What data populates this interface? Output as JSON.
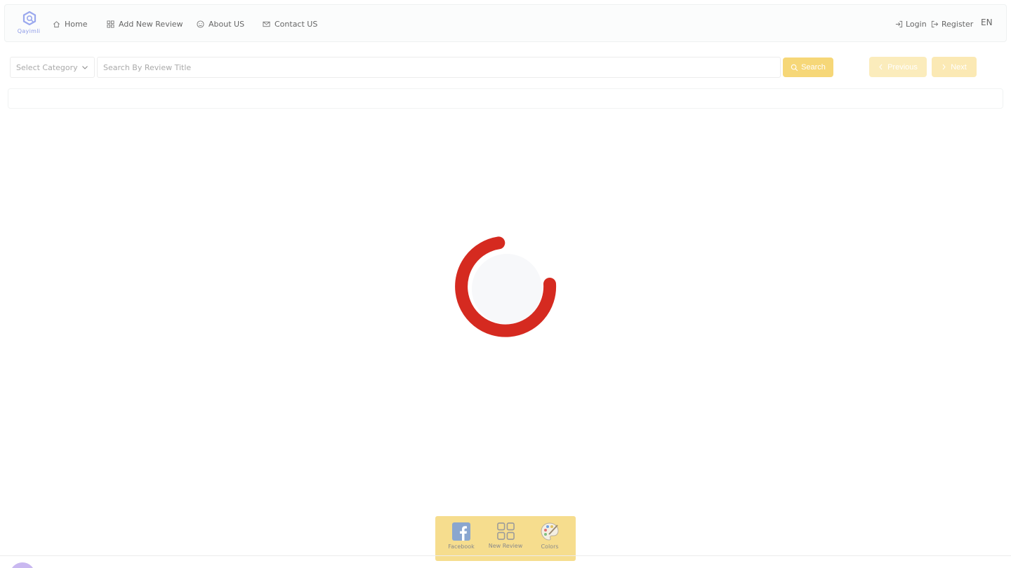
{
  "brand": {
    "logo_text": "Qayimli"
  },
  "nav": {
    "home": "Home",
    "add_review": "Add New Review",
    "about": "About US",
    "contact": "Contact US",
    "login": "Login",
    "register": "Register",
    "language": "EN"
  },
  "filters": {
    "category_placeholder": "Select Category",
    "search_placeholder": "Search By Review Title",
    "search_label": "Search",
    "previous_label": "Previous",
    "next_label": "Next"
  },
  "dock": {
    "facebook": "Facebook",
    "new_review": "New Review",
    "colors": "Colors"
  },
  "colors": {
    "accent": "#f6d778",
    "loader": "#d52a20",
    "logo": "#8e9be8"
  }
}
